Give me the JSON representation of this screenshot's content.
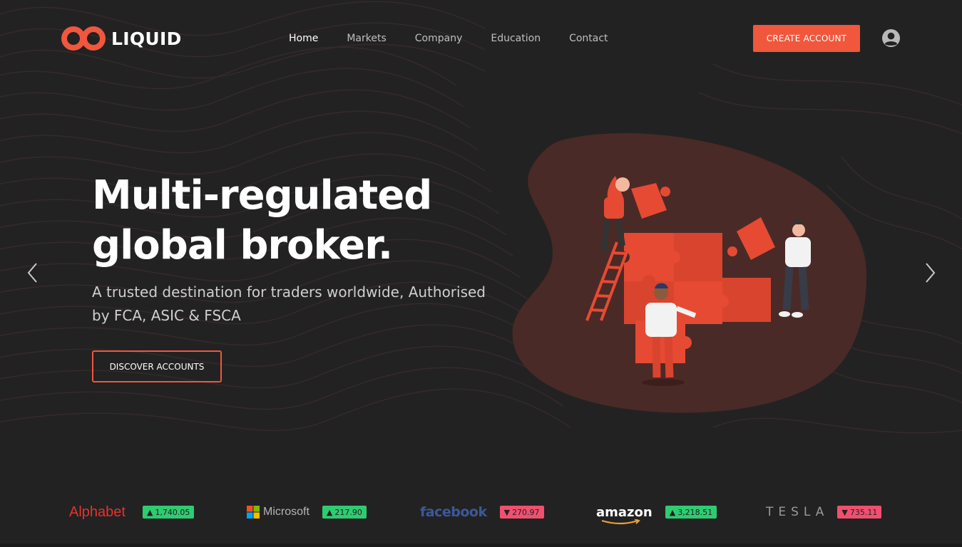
{
  "brand": {
    "name": "LIQUID"
  },
  "nav": {
    "items": [
      {
        "label": "Home",
        "active": true
      },
      {
        "label": "Markets",
        "active": false
      },
      {
        "label": "Company",
        "active": false
      },
      {
        "label": "Education",
        "active": false
      },
      {
        "label": "Contact",
        "active": false
      }
    ]
  },
  "header": {
    "create_account_label": "CREATE ACCOUNT",
    "user_icon": "user-circle-icon"
  },
  "hero": {
    "title_line1": "Multi-regulated",
    "title_line2": "global broker.",
    "subtitle": "A trusted destination for traders worldwide, Authorised by FCA, ASIC & FSCA",
    "cta_label": "DISCOVER ACCOUNTS"
  },
  "carousel": {
    "prev_icon": "chevron-left-icon",
    "next_icon": "chevron-right-icon"
  },
  "ticker": [
    {
      "brand": "Alphabet",
      "value": "1,740.05",
      "direction": "up"
    },
    {
      "brand": "Microsoft",
      "value": "217.90",
      "direction": "up"
    },
    {
      "brand": "facebook",
      "value": "270.97",
      "direction": "down"
    },
    {
      "brand": "amazon",
      "value": "3,218.51",
      "direction": "up"
    },
    {
      "brand": "TESLA",
      "value": "735.11",
      "direction": "down"
    }
  ],
  "colors": {
    "accent": "#f0573d",
    "background": "#222223",
    "up": "#2ecc71",
    "down": "#f0506e"
  }
}
